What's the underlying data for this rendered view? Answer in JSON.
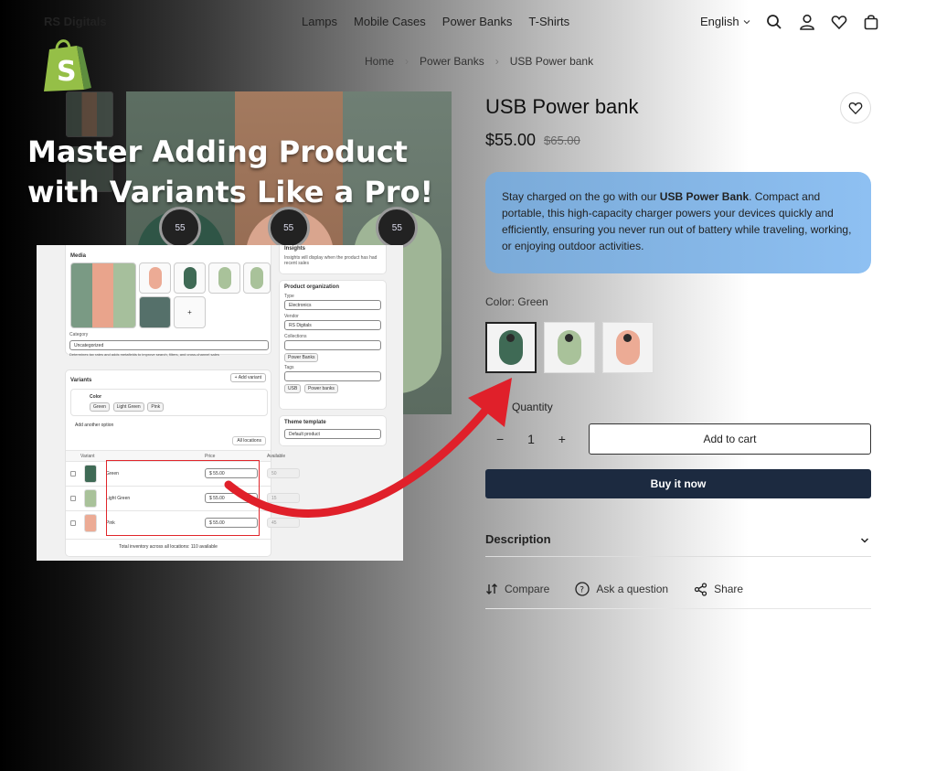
{
  "header": {
    "store_name": "RS Digitals",
    "nav": [
      "Lamps",
      "Mobile Cases",
      "Power Banks",
      "T-Shirts"
    ],
    "language": "English"
  },
  "breadcrumb": [
    "Home",
    "Power Banks",
    "USB Power bank"
  ],
  "overlay": {
    "headline": "Master Adding Product with Variants Like a Pro!",
    "logo": "shopify-bag-icon"
  },
  "gallery": {
    "screen_text": "55"
  },
  "admin": {
    "media_label": "Media",
    "add_tile": "+",
    "category_label": "Category",
    "category_value": "Uncategorized",
    "category_help": "Determines tax rates and adds metafields to improve search, filters, and cross-channel sales",
    "variants_label": "Variants",
    "add_variant": "+ Add variant",
    "option_name": "Color",
    "option_values": [
      "Green",
      "Light Green",
      "Pink"
    ],
    "add_option": "Add another option",
    "locations": "All locations",
    "col_variant": "Variant",
    "col_price": "Price",
    "col_available": "Available",
    "rows": [
      {
        "name": "Green",
        "price": "$  55.00",
        "available": "50"
      },
      {
        "name": "Light Green",
        "price": "$  55.00",
        "available": "15"
      },
      {
        "name": "Pink",
        "price": "$  55.00",
        "available": "45"
      }
    ],
    "total": "Total inventory across all locations: 110 available",
    "insights_label": "Insights",
    "insights_text": "Insights will display when the product has had recent sales",
    "org_label": "Product organization",
    "type_label": "Type",
    "type_value": "Electronics",
    "vendor_label": "Vendor",
    "vendor_value": "RS Digitals",
    "collections_label": "Collections",
    "collection_chip": "Power Banks",
    "tags_label": "Tags",
    "tags": [
      "USB",
      "Power banks"
    ],
    "theme_label": "Theme template",
    "theme_value": "Default product"
  },
  "product": {
    "title": "USB Power bank",
    "price": "$55.00",
    "compare_price": "$65.00",
    "desc_pre": "Stay charged on the go with our ",
    "desc_bold": "USB Power Bank",
    "desc_post": ". Compact and portable, this high-capacity charger powers your devices quickly and efficiently, ensuring you never run out of battery while traveling, working, or enjoying outdoor activities.",
    "color_label": "Color:",
    "color_value": "Green",
    "quantity_label": "Quantity",
    "quantity": "1",
    "minus": "−",
    "plus": "+",
    "add_to_cart": "Add to cart",
    "buy_now": "Buy it now",
    "description_tab": "Description",
    "compare": "Compare",
    "ask": "Ask a question",
    "share": "Share"
  },
  "colors": {
    "green": "#3f6a55",
    "light_green": "#a9c29a",
    "pink": "#ecab95",
    "buy_bg": "#1c2a40"
  }
}
